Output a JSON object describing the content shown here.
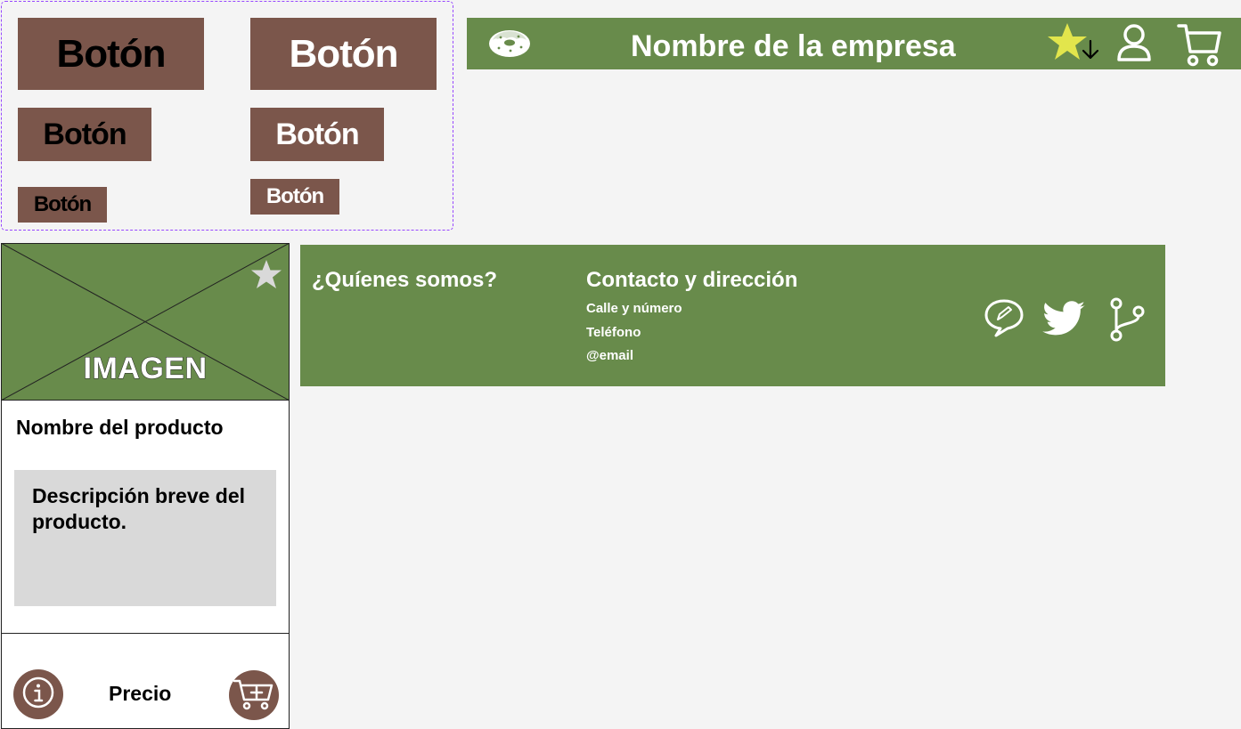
{
  "buttons": [
    {
      "label": "Botón",
      "size": "large",
      "style": "dark"
    },
    {
      "label": "Botón",
      "size": "large",
      "style": "light"
    },
    {
      "label": "Botón",
      "size": "medium",
      "style": "dark"
    },
    {
      "label": "Botón",
      "size": "medium",
      "style": "light"
    },
    {
      "label": "Botón",
      "size": "small",
      "style": "dark"
    },
    {
      "label": "Botón",
      "size": "small",
      "style": "light"
    }
  ],
  "header": {
    "company_name": "Nombre de la empresa",
    "icons": [
      "donut-logo-icon",
      "favorites-star-icon",
      "user-icon",
      "cart-icon"
    ]
  },
  "card": {
    "image_label": "IMAGEN",
    "product_name": "Nombre del producto",
    "description": "Descripción breve del producto.",
    "price": "Precio",
    "icons": [
      "favorite-star-icon",
      "info-icon",
      "add-to-cart-icon"
    ]
  },
  "footer": {
    "about_title": "¿Quíenes somos?",
    "contact_title": "Contacto y dirección",
    "contact_lines": [
      "Calle y número",
      "Teléfono",
      "@email"
    ],
    "icons": [
      "chat-icon",
      "twitter-icon",
      "git-branch-icon"
    ]
  },
  "colors": {
    "brand_green": "#688b4b",
    "brown": "#7b564b",
    "star_yellow": "#e2e54c",
    "background": "#f4f4f4"
  }
}
